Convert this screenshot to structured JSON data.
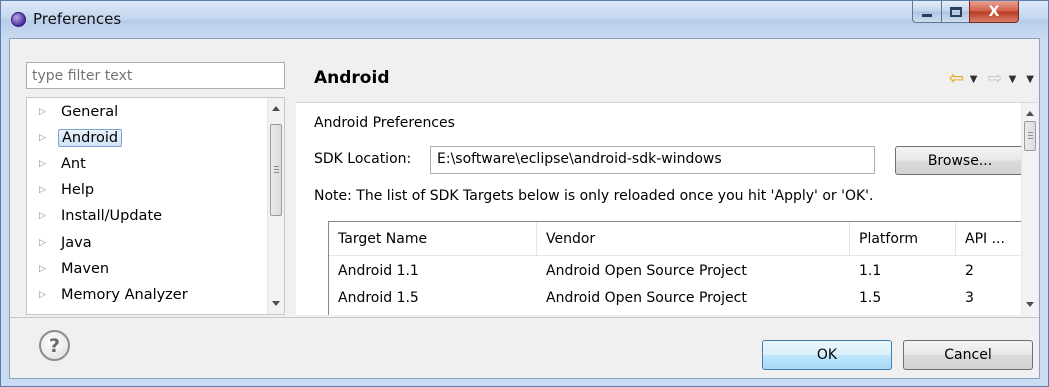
{
  "window": {
    "title": "Preferences",
    "close_glyph": "X"
  },
  "filter": {
    "placeholder": "type filter text"
  },
  "tree": {
    "items": [
      {
        "label": "General"
      },
      {
        "label": "Android",
        "selected": true
      },
      {
        "label": "Ant"
      },
      {
        "label": "Help"
      },
      {
        "label": "Install/Update"
      },
      {
        "label": "Java"
      },
      {
        "label": "Maven"
      },
      {
        "label": "Memory Analyzer"
      }
    ],
    "expander_glyph": "▷"
  },
  "page": {
    "title": "Android",
    "nav_back": "⇦",
    "nav_forward": "⇨",
    "nav_dropdown": "▼",
    "section_title": "Android Preferences",
    "sdk_label": "SDK Location:",
    "sdk_value": "E:\\software\\eclipse\\android-sdk-windows",
    "browse_label": "Browse...",
    "note": "Note: The list of SDK Targets below is only reloaded once you hit 'Apply' or 'OK'."
  },
  "targets_table": {
    "columns": [
      "Target Name",
      "Vendor",
      "Platform",
      "API ..."
    ],
    "rows": [
      [
        "Android 1.1",
        "Android Open Source Project",
        "1.1",
        "2"
      ],
      [
        "Android 1.5",
        "Android Open Source Project",
        "1.5",
        "3"
      ]
    ]
  },
  "footer": {
    "help_glyph": "?",
    "ok_label": "OK",
    "cancel_label": "Cancel"
  },
  "colors": {
    "titlebar": "#c5d8ef",
    "close_button": "#cf5c45",
    "selection": "#d0e3f8",
    "default_button_border": "#3c7fb1"
  }
}
